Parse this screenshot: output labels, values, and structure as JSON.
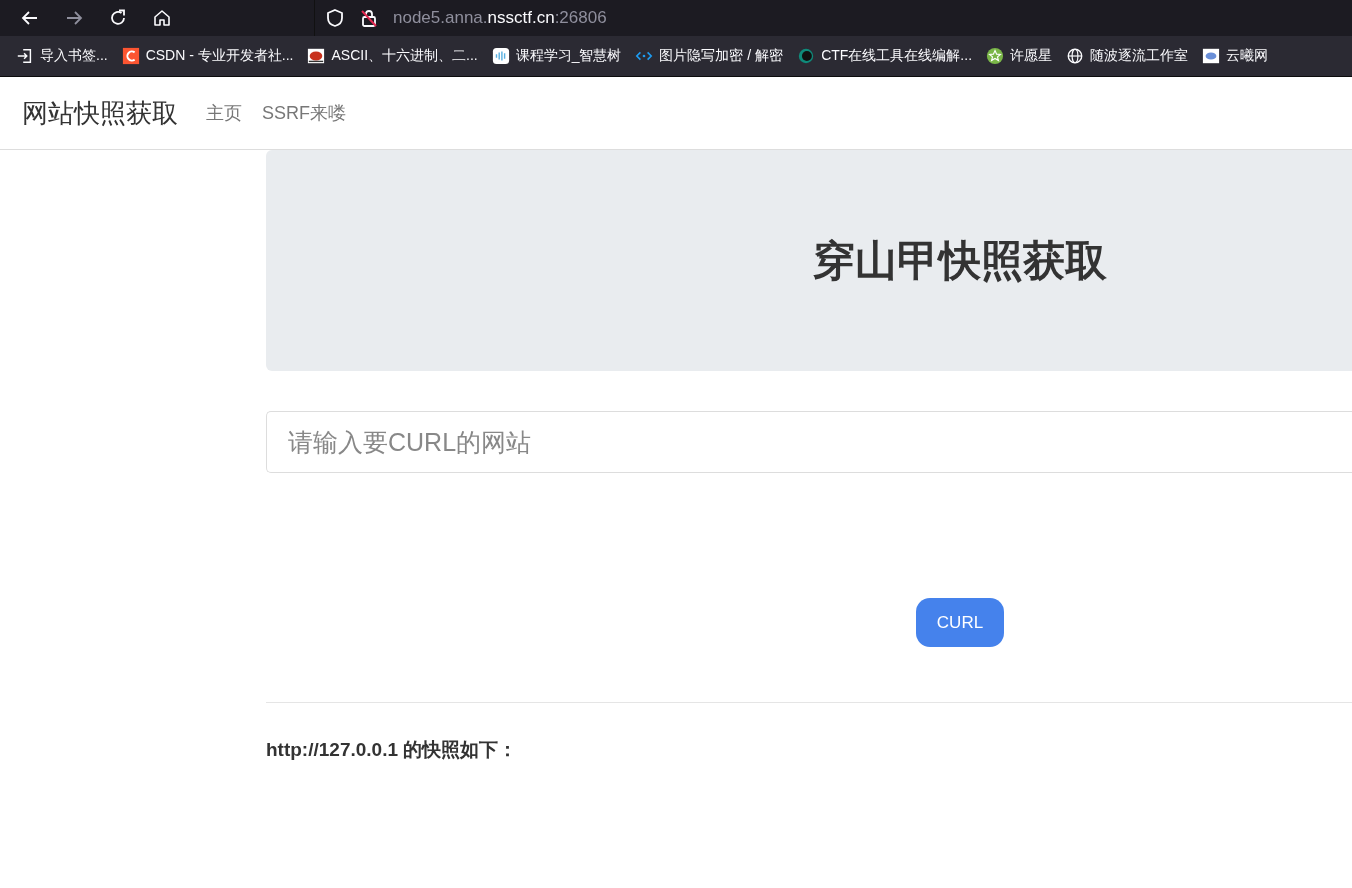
{
  "browser": {
    "nav_buttons": [
      {
        "kind": "back",
        "disabled": false
      },
      {
        "kind": "forward",
        "disabled": true
      },
      {
        "kind": "reload",
        "disabled": false
      },
      {
        "kind": "home",
        "disabled": false
      }
    ],
    "url": {
      "prefix": "node5.anna.",
      "domain": "nssctf.cn",
      "suffix": ":26806"
    },
    "bookmarks": [
      {
        "kind": "import",
        "label": "导入书签..."
      },
      {
        "kind": "letter",
        "label": "CSDN - 专业开发者社..."
      },
      {
        "kind": "ascii",
        "label": "ASCII、十六进制、二..."
      },
      {
        "kind": "bars",
        "label": "课程学习_智慧树"
      },
      {
        "kind": "code",
        "label": "图片隐写加密 / 解密"
      },
      {
        "kind": "ring",
        "label": "CTF在线工具在线编解..."
      },
      {
        "kind": "star",
        "label": "许愿星"
      },
      {
        "kind": "globe",
        "label": "随波逐流工作室"
      },
      {
        "kind": "cloud",
        "label": "云曦网"
      }
    ]
  },
  "navbar": {
    "brand": "网站快照获取",
    "links": [
      "主页",
      "SSRF来喽"
    ]
  },
  "jumbotron": {
    "title": "穿山甲快照获取"
  },
  "form": {
    "placeholder": "请输入要CURL的网站",
    "button": "CURL"
  },
  "result": {
    "text": "http://127.0.0.1 的快照如下："
  }
}
